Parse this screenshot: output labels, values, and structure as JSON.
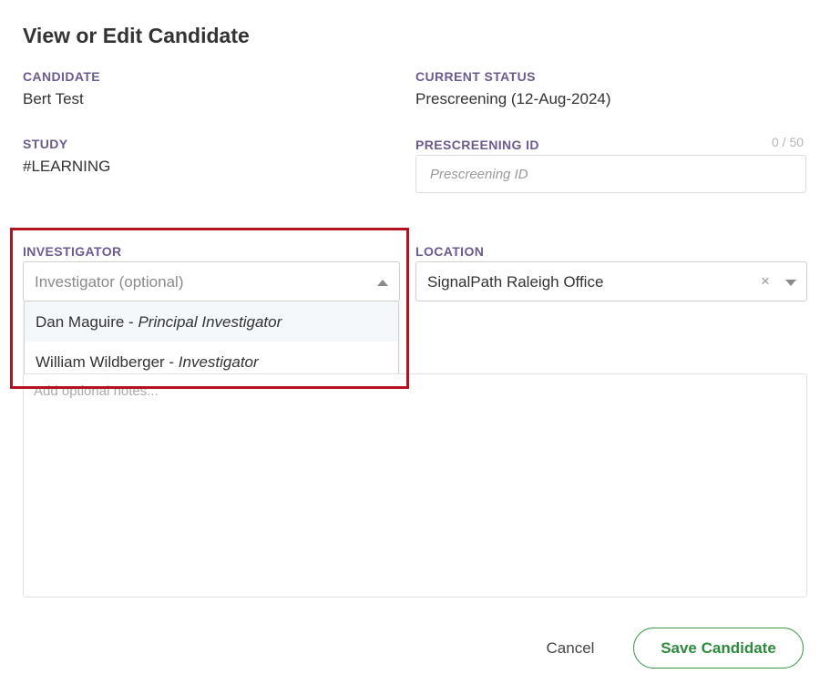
{
  "page": {
    "title": "View or Edit Candidate"
  },
  "candidate": {
    "label": "CANDIDATE",
    "value": "Bert Test"
  },
  "current_status": {
    "label": "CURRENT STATUS",
    "value": "Prescreening (12-Aug-2024)"
  },
  "study": {
    "label": "STUDY",
    "value": "#LEARNING"
  },
  "prescreening_id": {
    "label": "PRESCREENING ID",
    "counter": "0 / 50",
    "value": "",
    "placeholder": "Prescreening ID"
  },
  "investigator": {
    "label": "INVESTIGATOR",
    "placeholder": "Investigator (optional)",
    "is_open": true,
    "options": [
      {
        "name": "Dan Maguire",
        "separator": " - ",
        "role": "Principal Investigator"
      },
      {
        "name": "William Wildberger",
        "separator": " - ",
        "role": "Investigator"
      }
    ]
  },
  "location": {
    "label": "LOCATION",
    "value": "SignalPath Raleigh Office",
    "clear_icon": "close-icon",
    "dropdown_icon": "chevron-down-icon"
  },
  "notes": {
    "placeholder": "Add optional notes..."
  },
  "actions": {
    "cancel_label": "Cancel",
    "save_label": "Save Candidate"
  },
  "colors": {
    "label_purple": "#6c5b8f",
    "save_green": "#2e8b3e",
    "highlight_red": "#b3131e"
  }
}
